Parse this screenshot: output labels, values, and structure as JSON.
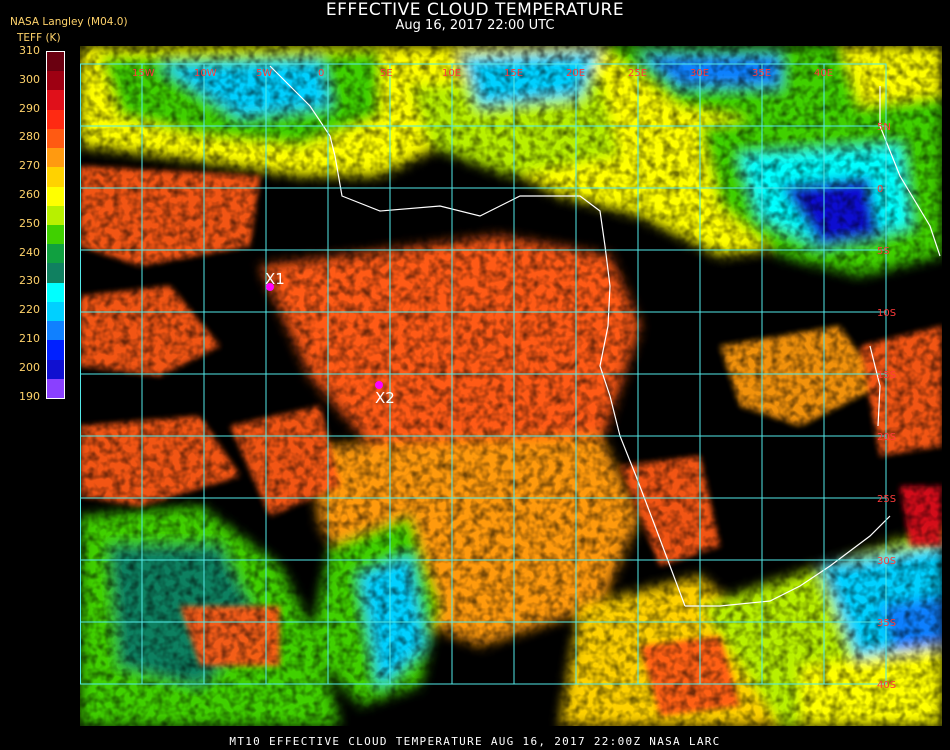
{
  "header": {
    "title": "EFFECTIVE CLOUD TEMPERATURE",
    "subtitle": "Aug 16, 2017 22:00 UTC",
    "source": "NASA Langley (M04.0)",
    "unit_label": "TEFF (K)"
  },
  "legend": {
    "ticks": [
      "310",
      "300",
      "290",
      "280",
      "270",
      "260",
      "250",
      "240",
      "230",
      "220",
      "210",
      "200",
      "190"
    ],
    "colors_top_to_bottom": [
      "#6a0010",
      "#9e0012",
      "#e0101a",
      "#ff2a12",
      "#ff5a12",
      "#ff9a10",
      "#ffd200",
      "#ffff00",
      "#b8f000",
      "#40d000",
      "#10a040",
      "#108060",
      "#00ffff",
      "#00d0ff",
      "#1080ff",
      "#0020ff",
      "#1010d0",
      "#8a40ff"
    ]
  },
  "map": {
    "background_color": "#000000",
    "grid_color": "#52e8e8",
    "coast_color": "#ffffff",
    "lat_labels": [
      "5N",
      "0",
      "5S",
      "10S",
      "15S",
      "20S",
      "25S",
      "30S",
      "35S",
      "40S"
    ],
    "lon_labels": [
      "15W",
      "10W",
      "5W",
      "0",
      "5E",
      "10E",
      "15E",
      "20E",
      "25E",
      "30E",
      "35E",
      "40E"
    ],
    "markers": [
      {
        "label": "X1",
        "color": "#ff00ff"
      },
      {
        "label": "X2",
        "color": "#ff00ff"
      }
    ]
  },
  "footer": {
    "text": "MT10  EFFECTIVE CLOUD TEMPERATURE   AUG 16, 2017 22:00Z   NASA LARC"
  }
}
